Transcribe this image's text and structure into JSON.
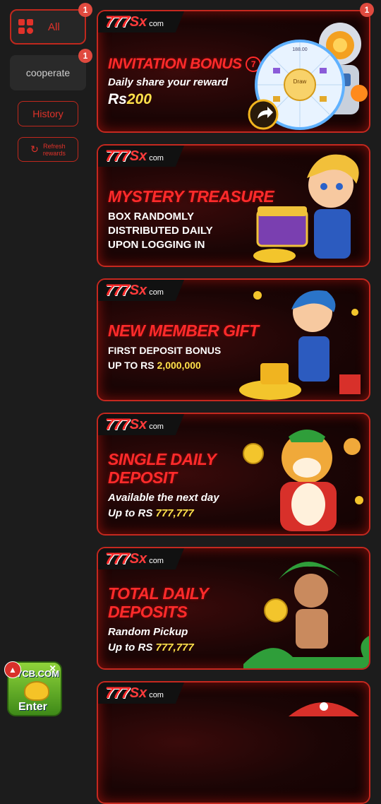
{
  "sidebar": {
    "tab_all": {
      "label": "All",
      "badge": "1"
    },
    "tab_cooperate": {
      "label": "cooperate",
      "badge": "1"
    },
    "history_label": "History",
    "refresh_label_line1": "Refresh",
    "refresh_label_line2": "rewards"
  },
  "banners": [
    {
      "brand": {
        "num": "777",
        "sx": "Sx",
        "com": "com"
      },
      "badge": "1",
      "title_line1": "INVITATION BONUS",
      "title_mark": "7",
      "sub_line1": "Daily share your reward",
      "amount_prefix": "Rs",
      "amount": "200",
      "wheel_center": "Draw",
      "wheel_top": "188.00"
    },
    {
      "brand": {
        "num": "777",
        "sx": "Sx",
        "com": "com"
      },
      "title_line1": "MYSTERY TREASURE",
      "sub_line1": "BOX RANDOMLY",
      "sub_line2": "DISTRIBUTED DAILY",
      "sub_line3": "UPON LOGGING IN"
    },
    {
      "brand": {
        "num": "777",
        "sx": "Sx",
        "com": "com"
      },
      "title_line1": "NEW MEMBER GIFT",
      "sub_line1": "FIRST DEPOSIT BONUS",
      "sub_line2_prefix": "UP TO RS ",
      "sub_line2_value": "2,000,000"
    },
    {
      "brand": {
        "num": "777",
        "sx": "Sx",
        "com": "com"
      },
      "title_line1": "SINGLE DAILY",
      "title_line2": "DEPOSIT",
      "sub_line1": "Available the next day",
      "sub_line2_prefix": "Up to RS ",
      "sub_line2_value": "777,777"
    },
    {
      "brand": {
        "num": "777",
        "sx": "Sx",
        "com": "com"
      },
      "title_line1": "TOTAL DAILY",
      "title_line2": "DEPOSITS",
      "sub_line1": "Random Pickup",
      "sub_line2_prefix": "Up to RS ",
      "sub_line2_value": "777,777"
    },
    {
      "brand": {
        "num": "777",
        "sx": "Sx",
        "com": "com"
      }
    }
  ],
  "floating_widget": {
    "logo": "7CB.COM",
    "enter": "Enter",
    "close": "×"
  },
  "colors": {
    "accent": "#e0322a",
    "background": "#1c1c1c",
    "highlight": "#ffe14a"
  }
}
